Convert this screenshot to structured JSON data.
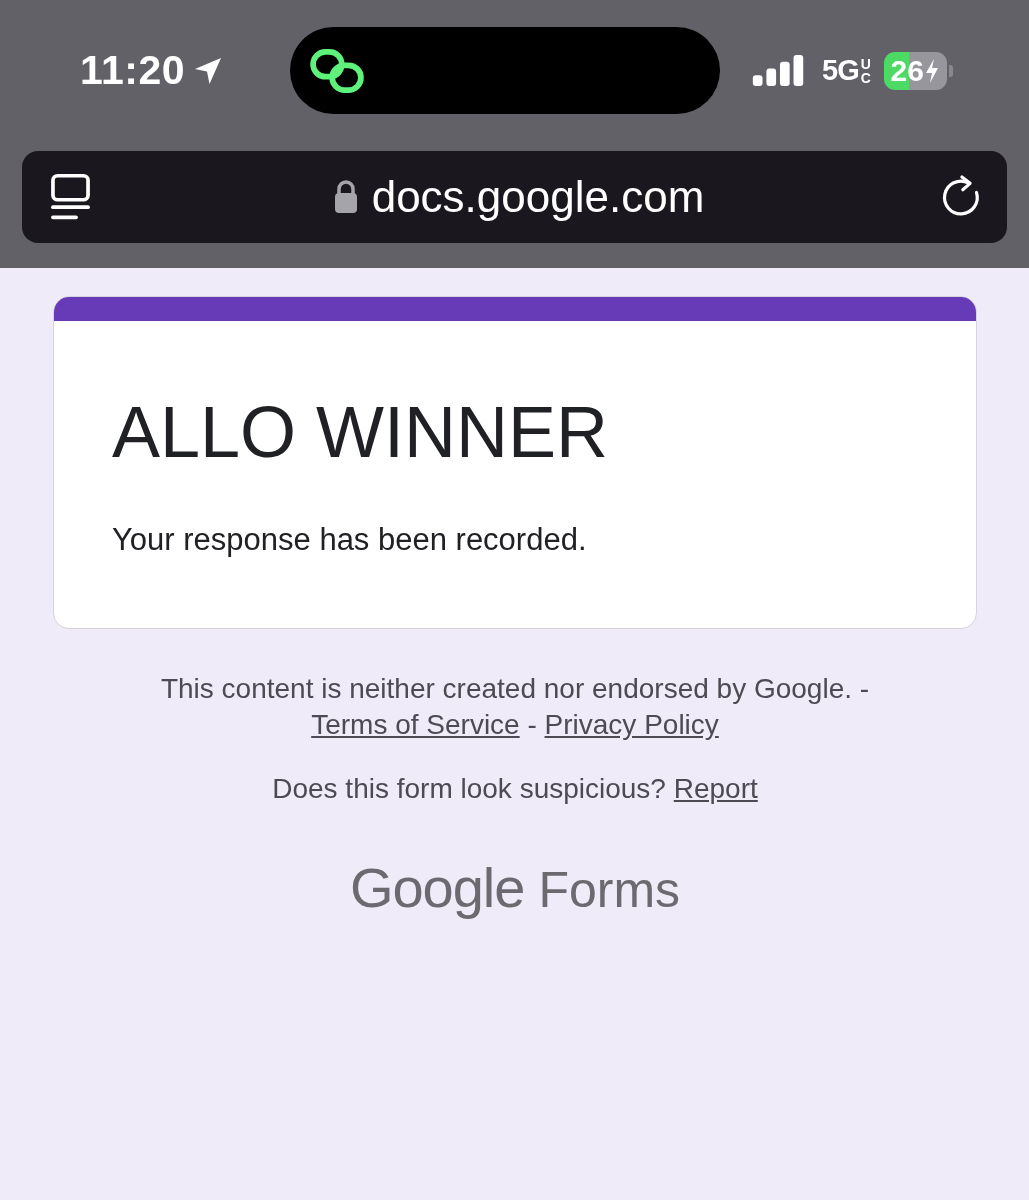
{
  "status_bar": {
    "time": "11:20",
    "network": "5G",
    "network_badge": "UC",
    "battery": "26"
  },
  "address_bar": {
    "url": "docs.google.com"
  },
  "form": {
    "title": "ALLO WINNER",
    "message": "Your response has been recorded."
  },
  "footer": {
    "disclaimer": [
      {
        "kind": "text",
        "text": "This content is neither created nor endorsed by Google. -"
      },
      {
        "kind": "link",
        "text": "Terms of Service"
      },
      {
        "kind": "text",
        "text": "-"
      },
      {
        "kind": "link",
        "text": "Privacy Policy"
      }
    ],
    "report": [
      {
        "kind": "text",
        "text": "Does this form look suspicious?"
      },
      {
        "kind": "link",
        "text": "Report"
      }
    ],
    "logo": {
      "brand": "Google",
      "product": "Forms"
    }
  }
}
